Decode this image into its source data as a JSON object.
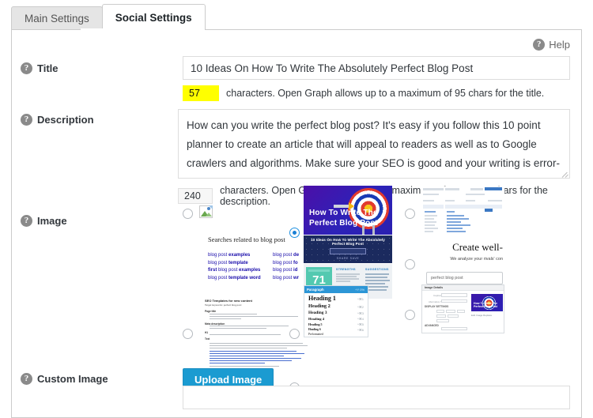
{
  "tabs": [
    {
      "label": "Main Settings",
      "active": false
    },
    {
      "label": "Social Settings",
      "active": true
    }
  ],
  "help": {
    "label": "Help",
    "icon": "question-mark-icon"
  },
  "fields": {
    "title": {
      "label": "Title",
      "value": "10 Ideas On How To Write The Absolutely Perfect Blog Post",
      "placeholder": "",
      "counter": "57",
      "counter_note": "characters. Open Graph allows up to a maximum of 95 chars for the title.",
      "counter_highlight": "#ffff00"
    },
    "description": {
      "label": "Description",
      "value": "How can you write the perfect blog post? It's easy if you follow this 10 point planner to create an article that will appeal to readers as well as to Google crawlers and algorithms. Make sure your SEO is good and your writing is error-free.",
      "placeholder": "",
      "counter": "240",
      "counter_note": "characters. Open Graph allows up to a maximum of 910-1000 chars for the description."
    },
    "image": {
      "label": "Image",
      "options": [
        {
          "id": "opt-broken",
          "selected": false,
          "kind": "broken-image-thumbnail"
        },
        {
          "id": "opt-searches",
          "selected": false,
          "kind": "google-related-searches-thumbnail"
        },
        {
          "id": "opt-doc",
          "selected": false,
          "kind": "document-text-thumbnail"
        },
        {
          "id": "opt-hero",
          "selected": true,
          "kind": "blog-post-hero-thumbnail"
        },
        {
          "id": "opt-score",
          "selected": false,
          "kind": "seo-score-card-thumbnail"
        },
        {
          "id": "opt-headings",
          "selected": false,
          "kind": "headings-list-thumbnail"
        },
        {
          "id": "opt-table",
          "selected": false,
          "kind": "keyword-table-thumbnail"
        },
        {
          "id": "opt-createwell",
          "selected": false,
          "kind": "create-well-thumbnail"
        },
        {
          "id": "opt-dialog",
          "selected": false,
          "kind": "image-details-dialog-thumbnail"
        }
      ]
    },
    "custom_image": {
      "label": "Custom Image",
      "upload_button": "Upload Image",
      "value": "",
      "placeholder": ""
    }
  },
  "thumbnails": {
    "related_searches": {
      "heading": "Searches related to blog post",
      "left": [
        [
          "blog post ",
          "examples"
        ],
        [
          "blog post ",
          "template"
        ],
        [
          "first ",
          "blog post ",
          "examples"
        ],
        [
          "blog post ",
          "template word"
        ]
      ],
      "right": [
        [
          "blog post ",
          "de"
        ],
        [
          "blog post ",
          "fo"
        ],
        [
          "blog post ",
          "id"
        ],
        [
          "blog post ",
          "wr"
        ]
      ]
    },
    "hero": {
      "line1": "How To Write The",
      "line2": "Perfect Blog Post",
      "bg": "#3a16ad"
    },
    "navy_banner": {
      "title": "10 Ideas On How To Write The Absolutely Perfect Blog Post",
      "sub": "SHARE   SAVE",
      "bg": "#1b2a5e"
    },
    "score_card": {
      "score": "71",
      "col1": "STRENGTHS",
      "col2": "SUGGESTIONS",
      "accent": "#53c9b0"
    },
    "headings": {
      "bar_left": "Paragraph",
      "bar_right": "+Y 0%",
      "rows": [
        {
          "label": "Heading 1",
          "meta": "^⌘1"
        },
        {
          "label": "Heading 2",
          "meta": "^⌘2"
        },
        {
          "label": "Heading 3",
          "meta": "^⌘3"
        },
        {
          "label": "Heading 4",
          "meta": "^⌘4"
        },
        {
          "label": "Heading 5",
          "meta": "^⌘5"
        },
        {
          "label": "Heading 6",
          "meta": "^⌘6"
        },
        {
          "label": "Preformatted",
          "meta": ""
        }
      ],
      "accent": "#2c96d6"
    },
    "create_well": {
      "headline": "Create well-",
      "sub": "We analyze your rivals' con",
      "input_value": "perfect blog post"
    },
    "dialog": {
      "title": "Image Details",
      "close": "×",
      "caption": "Edit Image   Replace"
    }
  },
  "colors": {
    "accent_blue": "#1b9bd1",
    "radio_selected": "#1a7fd4",
    "highlight_yellow": "#ffff00",
    "panel_border": "#cccccc",
    "tab_inactive_bg": "#e5e5e5"
  }
}
